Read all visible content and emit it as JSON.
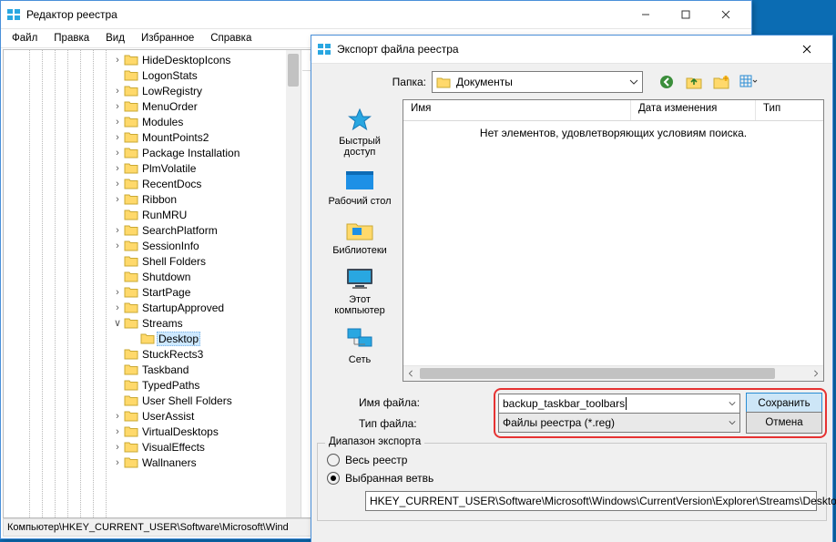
{
  "regedit": {
    "title": "Редактор реестра",
    "menu": [
      "Файл",
      "Правка",
      "Вид",
      "Избранное",
      "Справка"
    ],
    "tree_indent_base": 116,
    "tree": [
      {
        "label": "HideDesktopIcons",
        "tw": ">",
        "depth": 0
      },
      {
        "label": "LogonStats",
        "tw": "",
        "depth": 0
      },
      {
        "label": "LowRegistry",
        "tw": ">",
        "depth": 0
      },
      {
        "label": "MenuOrder",
        "tw": ">",
        "depth": 0
      },
      {
        "label": "Modules",
        "tw": ">",
        "depth": 0
      },
      {
        "label": "MountPoints2",
        "tw": ">",
        "depth": 0
      },
      {
        "label": "Package Installation",
        "tw": ">",
        "depth": 0
      },
      {
        "label": "PlmVolatile",
        "tw": ">",
        "depth": 0
      },
      {
        "label": "RecentDocs",
        "tw": ">",
        "depth": 0
      },
      {
        "label": "Ribbon",
        "tw": ">",
        "depth": 0
      },
      {
        "label": "RunMRU",
        "tw": "",
        "depth": 0
      },
      {
        "label": "SearchPlatform",
        "tw": ">",
        "depth": 0
      },
      {
        "label": "SessionInfo",
        "tw": ">",
        "depth": 0
      },
      {
        "label": "Shell Folders",
        "tw": "",
        "depth": 0
      },
      {
        "label": "Shutdown",
        "tw": "",
        "depth": 0
      },
      {
        "label": "StartPage",
        "tw": ">",
        "depth": 0
      },
      {
        "label": "StartupApproved",
        "tw": ">",
        "depth": 0
      },
      {
        "label": "Streams",
        "tw": "v",
        "depth": 0
      },
      {
        "label": "Desktop",
        "tw": "",
        "depth": 1,
        "selected": true
      },
      {
        "label": "StuckRects3",
        "tw": "",
        "depth": 0
      },
      {
        "label": "Taskband",
        "tw": "",
        "depth": 0
      },
      {
        "label": "TypedPaths",
        "tw": "",
        "depth": 0
      },
      {
        "label": "User Shell Folders",
        "tw": "",
        "depth": 0
      },
      {
        "label": "UserAssist",
        "tw": ">",
        "depth": 0
      },
      {
        "label": "VirtualDesktops",
        "tw": ">",
        "depth": 0
      },
      {
        "label": "VisualEffects",
        "tw": ">",
        "depth": 0
      },
      {
        "label": "Wallnaners",
        "tw": ">",
        "depth": 0
      }
    ],
    "list_header": "И",
    "status": "Компьютер\\HKEY_CURRENT_USER\\Software\\Microsoft\\Wind"
  },
  "dlg": {
    "title": "Экспорт файла реестра",
    "folder_label": "Папка:",
    "folder_value": "Документы",
    "places": [
      "Быстрый доступ",
      "Рабочий стол",
      "Библиотеки",
      "Этот компьютер",
      "Сеть"
    ],
    "cols": {
      "name": "Имя",
      "date": "Дата изменения",
      "type": "Тип"
    },
    "empty_msg": "Нет элементов, удовлетворяющих условиям поиска.",
    "file_name_label": "Имя файла:",
    "file_name_value": "backup_taskbar_toolbars",
    "file_type_label": "Тип файла:",
    "file_type_value": "Файлы реестра (*.reg)",
    "btn_save": "Сохранить",
    "btn_cancel": "Отмена",
    "range_caption": "Диапазон экспорта",
    "range_all": "Весь реестр",
    "range_branch": "Выбранная ветвь",
    "branch_path": "HKEY_CURRENT_USER\\Software\\Microsoft\\Windows\\CurrentVersion\\Explorer\\Streams\\Desktop"
  },
  "colors": {
    "accent": "#2a8dd4",
    "highlight_red": "#e63232"
  }
}
